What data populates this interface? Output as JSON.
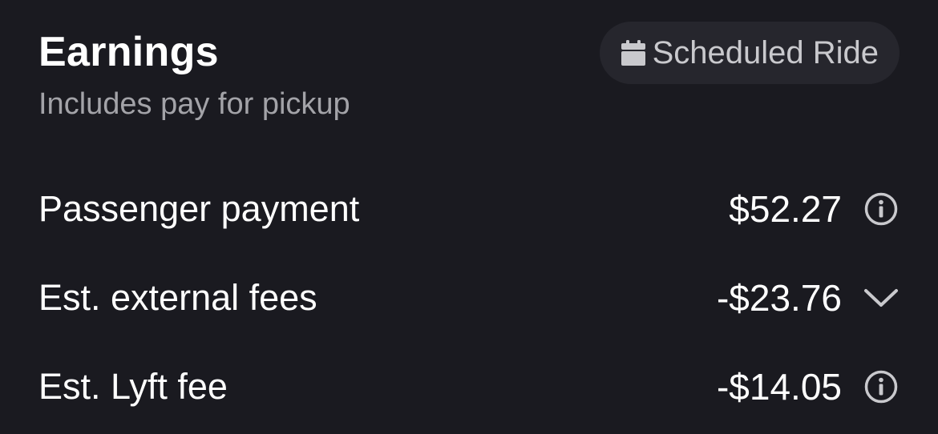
{
  "header": {
    "title": "Earnings",
    "subtitle": "Includes pay for pickup"
  },
  "badge": {
    "label": "Scheduled Ride",
    "icon": "calendar-icon"
  },
  "rows": [
    {
      "label": "Passenger payment",
      "value": "$52.27",
      "icon": "info-icon"
    },
    {
      "label": "Est. external fees",
      "value": "-$23.76",
      "icon": "chevron-down-icon"
    },
    {
      "label": "Est. Lyft fee",
      "value": "-$14.05",
      "icon": "info-icon"
    }
  ],
  "colors": {
    "background": "#1a1a20",
    "badge_background": "#26262d",
    "secondary_text": "#a3a3a8",
    "icon": "#c9c9cd"
  }
}
